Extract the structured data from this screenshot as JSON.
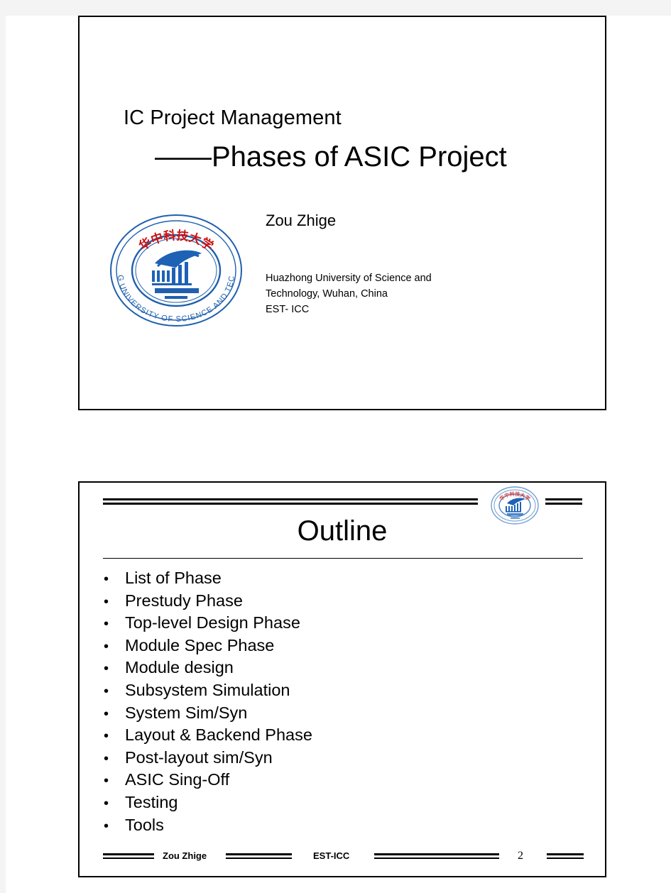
{
  "document": {
    "type": "presentation-handout",
    "page_background": "#f4f4f4",
    "sheet_background": "#ffffff"
  },
  "slide_title": {
    "title_line_1": "IC Project Management",
    "title_line_2": "——Phases of ASIC Project",
    "author": "Zou Zhige",
    "affiliation_line_1": "Huazhong University of Science and",
    "affiliation_line_2": "Technology, Wuhan, China",
    "affiliation_line_3": "EST- ICC",
    "logo": {
      "name": "hust-university-seal",
      "chinese_text": "华中科技大学",
      "ring_text": "HUAZHONG UNIVERSITY OF SCIENCE AND TECHNOLOGY",
      "monogram": "HUST",
      "ring_color": "#1f5fae",
      "chinese_color": "#cc1111",
      "monogram_color": "#1d62b5"
    }
  },
  "slide_outline": {
    "header_title": "Outline",
    "logo": {
      "name": "hust-university-seal-small",
      "ring_color": "#6f9fd0",
      "chinese_color": "#d04040",
      "monogram_color": "#1d62b5"
    },
    "bullet_marker": "•",
    "items": [
      "List of Phase",
      "Prestudy Phase",
      "Top-level Design Phase",
      "Module Spec Phase",
      "Module design",
      "Subsystem Simulation",
      "System Sim/Syn",
      "Layout & Backend Phase",
      "Post-layout sim/Syn",
      "ASIC Sing-Off",
      "Testing",
      "Tools"
    ],
    "footer": {
      "author": "Zou Zhige",
      "organization": "EST-ICC",
      "page_number": "2"
    }
  }
}
